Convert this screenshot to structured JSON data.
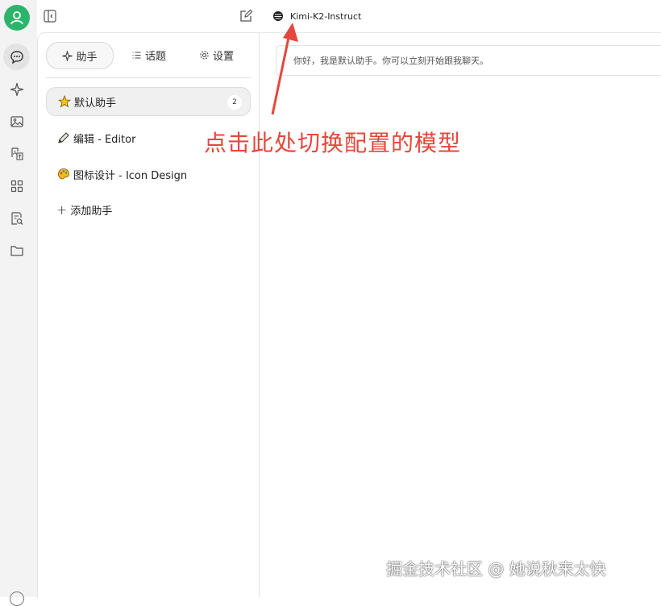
{
  "rail": {
    "items": [
      "chat-icon",
      "sparkle-icon",
      "image-icon",
      "translate-icon",
      "apps-icon",
      "document-search-icon",
      "folder-icon"
    ]
  },
  "topbar": {
    "model_name": "Kimi-K2-Instruct"
  },
  "panel": {
    "tabs": [
      {
        "label": "助手",
        "icon": "sparkle-icon"
      },
      {
        "label": "话题",
        "icon": "list-icon"
      },
      {
        "label": "设置",
        "icon": "gear-icon"
      }
    ],
    "assistants": [
      {
        "label": "默认助手",
        "icon": "star-emoji",
        "count": "2"
      },
      {
        "label": "编辑 - Editor",
        "icon": "pencil-emoji"
      },
      {
        "label": "图标设计 - Icon Design",
        "icon": "palette-emoji"
      }
    ],
    "add_label": "添加助手"
  },
  "chat": {
    "greeting": "你好，我是默认助手。你可以立刻开始跟我聊天。"
  },
  "annotation": {
    "text": "点击此处切换配置的模型",
    "color": "#e6463c"
  },
  "watermark": "掘金技术社区 @ 她说秋来太快",
  "colors": {
    "accent": "#2db46b",
    "annotation": "#e6463c"
  }
}
